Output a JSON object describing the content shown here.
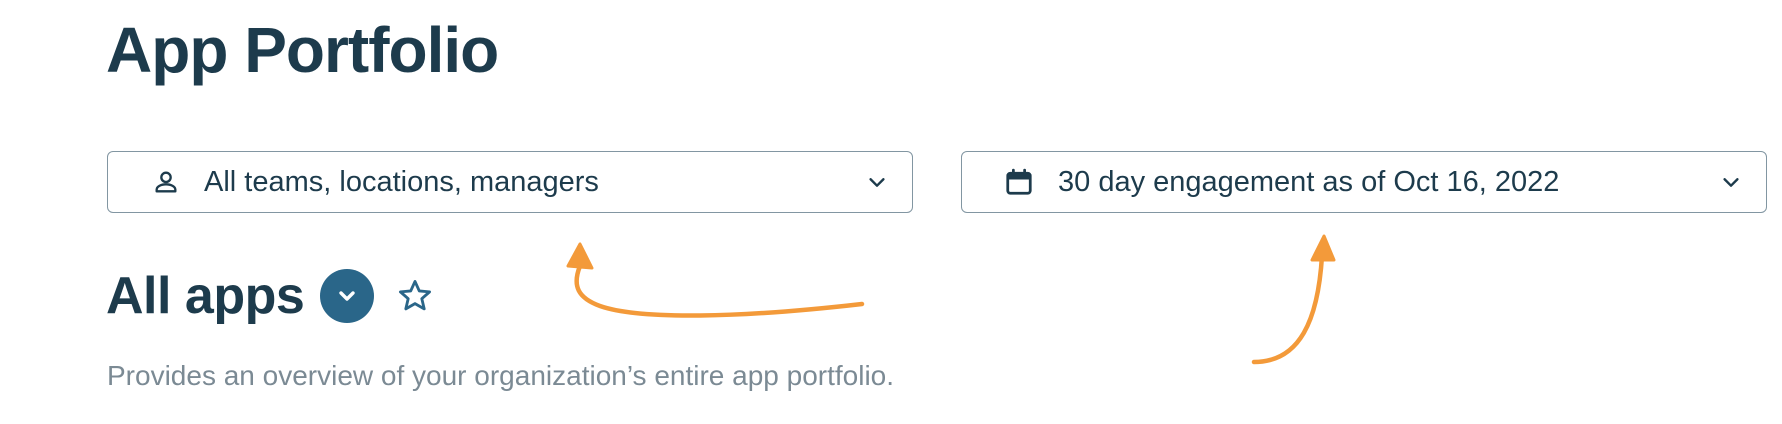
{
  "page": {
    "title": "App Portfolio"
  },
  "filters": {
    "team": {
      "label": "All teams, locations, managers",
      "icon": "person-icon"
    },
    "date": {
      "label": "30 day engagement as of Oct 16, 2022",
      "icon": "calendar-icon"
    }
  },
  "section": {
    "title": "All apps",
    "description": "Provides an overview of your organization’s entire app portfolio."
  },
  "colors": {
    "title": "#1d3b4c",
    "accent": "#2a6689",
    "muted": "#7b8a94",
    "border": "#8296a2",
    "annotation": "#f39a3a"
  }
}
